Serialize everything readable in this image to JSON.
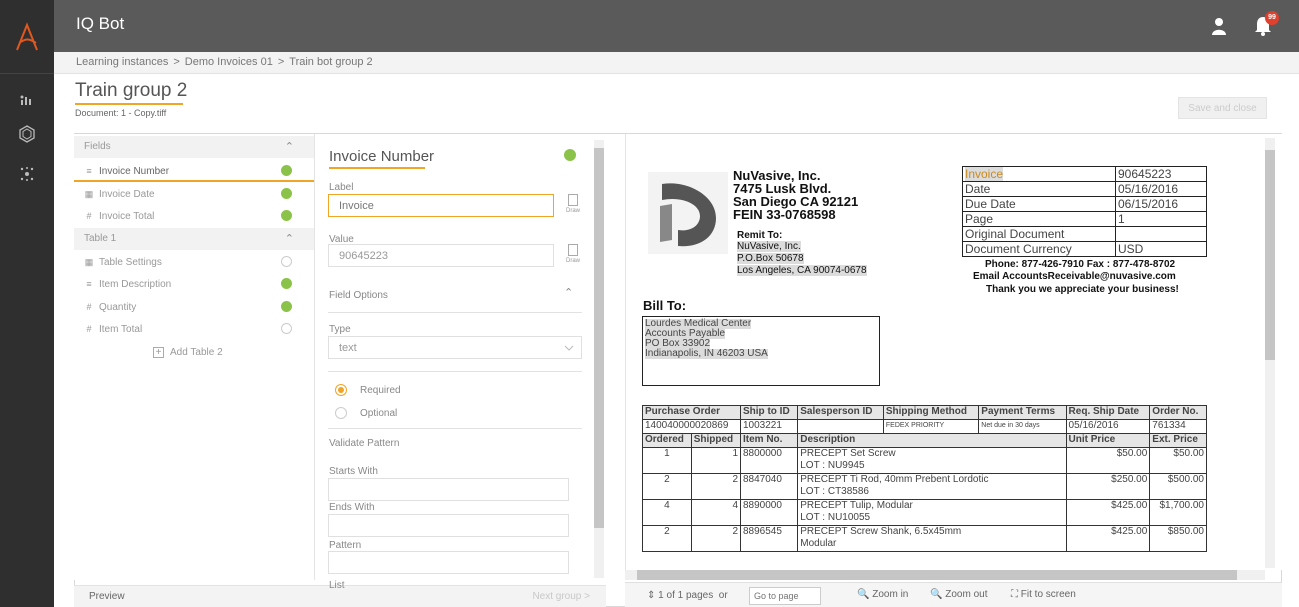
{
  "app": {
    "title": "IQ Bot",
    "notification_count": "99"
  },
  "breadcrumb": [
    "Learning instances",
    "Demo Invoices 01",
    "Train bot group 2"
  ],
  "breadcrumb_sep": ">",
  "page": {
    "title": "Train group 2",
    "document_label": "Document: 1 - Copy.tiff",
    "save_button": "Save and close"
  },
  "fields_panel": {
    "fields_header": "Fields",
    "fields": [
      "Invoice Number",
      "Invoice Date",
      "Invoice Total"
    ],
    "table_header": "Table 1",
    "table_items": [
      "Table Settings",
      "Item Description",
      "Quantity",
      "Item Total"
    ],
    "add_table": "Add Table 2"
  },
  "footer": {
    "preview": "Preview",
    "next_group": "Next group >"
  },
  "field_detail": {
    "title": "Invoice Number",
    "label_caption": "Label",
    "label_value": "Invoice",
    "value_caption": "Value",
    "value_value": "90645223",
    "draw": "Draw",
    "field_options": "Field Options",
    "type_caption": "Type",
    "type_value": "text",
    "required": "Required",
    "optional": "Optional",
    "validate_pattern": "Validate Pattern",
    "starts_with": "Starts With",
    "ends_with": "Ends With",
    "pattern": "Pattern",
    "list": "List"
  },
  "viewer": {
    "page_info": "1 of 1 pages",
    "or": "or",
    "goto_placeholder": "Go to page",
    "zoom_in": "Zoom in",
    "zoom_out": "Zoom out",
    "fit": "Fit to screen"
  },
  "document": {
    "company": [
      "NuVasive, Inc.",
      "7475 Lusk Blvd.",
      "San Diego CA  92121",
      "FEIN 33-0768598"
    ],
    "remit_to": "Remit To:",
    "remit_lines": [
      "NuVasive, Inc.",
      "P.O.Box 50678",
      "Los Angeles, CA 90074-0678"
    ],
    "invoice_table": [
      [
        "Invoice",
        "90645223"
      ],
      [
        "Date",
        "05/16/2016"
      ],
      [
        "Due Date",
        "06/15/2016"
      ],
      [
        "Page",
        "1"
      ],
      [
        "Original Document",
        ""
      ],
      [
        "Document Currency",
        "USD"
      ]
    ],
    "phone_line": "Phone: 877-426-7910   Fax : 877-478-8702",
    "email_line": "Email  AccountsReceivable@nuvasive.com",
    "thanks": "Thank you we appreciate your business!",
    "bill_to": "Bill To:",
    "bill_lines": [
      "Lourdes Medical Center",
      "Accounts Payable",
      "PO Box 33902",
      "Indianapolis, IN 46203 USA"
    ],
    "po_headers": [
      "Purchase Order",
      "Ship to ID",
      "Salesperson ID",
      "Shipping Method",
      "Payment Terms",
      "Req. Ship Date",
      "Order No."
    ],
    "po_values": [
      "140040000020869",
      "1003221",
      "",
      "FEDEX PRIORITY",
      "Net due in 30 days",
      "05/16/2016",
      "761334"
    ],
    "item_headers": [
      "Ordered",
      "Shipped",
      "Item No.",
      "Description",
      "Unit Price",
      "Ext. Price"
    ],
    "items": [
      [
        "1",
        "1",
        "8800000",
        "PRECEPT Set Screw",
        "LOT : NU9945",
        "$50.00",
        "$50.00"
      ],
      [
        "2",
        "2",
        "8847040",
        "PRECEPT Ti Rod, 40mm Prebent Lordotic",
        "LOT : CT38586",
        "$250.00",
        "$500.00"
      ],
      [
        "4",
        "4",
        "8890000",
        "PRECEPT Tulip, Modular",
        "LOT : NU10055",
        "$425.00",
        "$1,700.00"
      ],
      [
        "2",
        "2",
        "8896545",
        "PRECEPT Screw Shank, 6.5x45mm",
        "Modular",
        "$425.00",
        "$850.00"
      ]
    ]
  }
}
